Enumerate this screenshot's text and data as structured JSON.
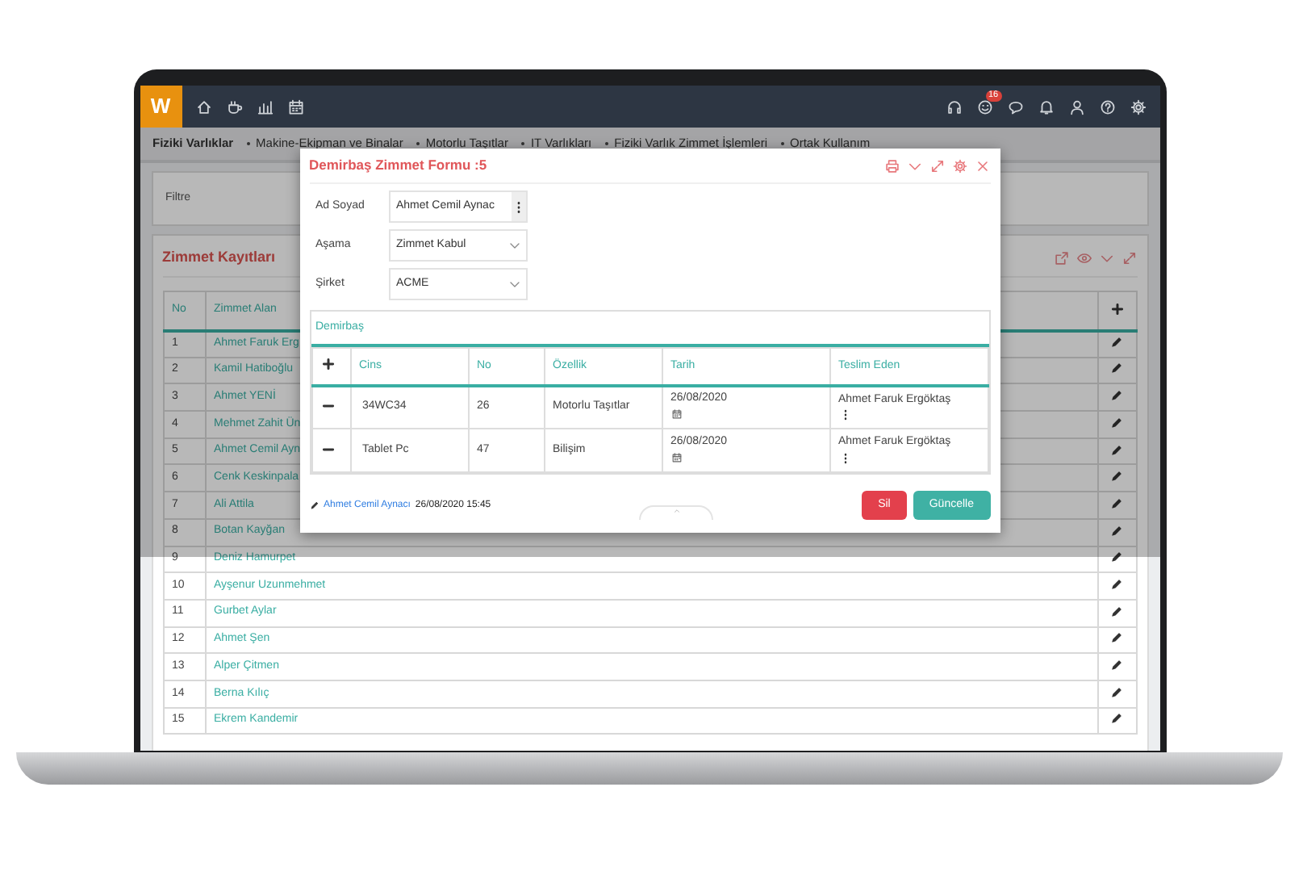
{
  "navbar": {
    "logo": "W",
    "notification_count": "16"
  },
  "breadcrumb": [
    {
      "label": "Fiziki Varlıklar",
      "kind": "root"
    },
    {
      "label": "Makine-Ekipman ve Binalar",
      "kind": "link"
    },
    {
      "label": "Motorlu Taşıtlar",
      "kind": "link"
    },
    {
      "label": "IT Varlıkları",
      "kind": "link"
    },
    {
      "label": "Fiziki Varlık Zimmet İşlemleri",
      "kind": "link"
    },
    {
      "label": "Ortak Kullanım",
      "kind": "link"
    }
  ],
  "filter": {
    "label": "Filtre"
  },
  "records": {
    "title": "Zimmet Kayıtları",
    "columns": [
      "No",
      "Zimmet Alan"
    ],
    "rows": [
      {
        "no": "1",
        "name": "Ahmet Faruk Erg"
      },
      {
        "no": "2",
        "name": "Kamil Hatiboğlu"
      },
      {
        "no": "3",
        "name": "Ahmet YENİ"
      },
      {
        "no": "4",
        "name": "Mehmet Zahit Ün"
      },
      {
        "no": "5",
        "name": "Ahmet Cemil Ayn"
      },
      {
        "no": "6",
        "name": "Cenk Keskinpala"
      },
      {
        "no": "7",
        "name": "Ali Attila"
      },
      {
        "no": "8",
        "name": "Botan Kayğan"
      },
      {
        "no": "9",
        "name": "Deniz Hamurpet"
      },
      {
        "no": "10",
        "name": "Ayşenur Uzunmehmet"
      },
      {
        "no": "11",
        "name": "Gurbet Aylar"
      },
      {
        "no": "12",
        "name": "Ahmet Şen"
      },
      {
        "no": "13",
        "name": "Alper Çitmen"
      },
      {
        "no": "14",
        "name": "Berna Kılıç"
      },
      {
        "no": "15",
        "name": "Ekrem Kandemir"
      }
    ]
  },
  "modal": {
    "title": "Demirbaş Zimmet Formu :5",
    "fields": [
      {
        "label": "Ad Soyad",
        "value": "Ahmet Cemil Aynac",
        "kind": "lookup"
      },
      {
        "label": "Aşama",
        "value": "Zimmet Kabul",
        "kind": "select"
      },
      {
        "label": "Şirket",
        "value": "ACME",
        "kind": "select"
      }
    ],
    "assets": {
      "title": "Demirbaş",
      "columns": [
        "Cins",
        "No",
        "Özellik",
        "Tarih",
        "Teslim Eden"
      ],
      "rows": [
        {
          "type": "34WC34",
          "no": "26",
          "feature": "Motorlu Taşıtlar",
          "date": "26/08/2020",
          "delivered_by": "Ahmet Faruk Ergöktaş"
        },
        {
          "type": "Tablet Pc",
          "no": "47",
          "feature": "Bilişim",
          "date": "26/08/2020",
          "delivered_by": "Ahmet Faruk Ergöktaş"
        }
      ]
    },
    "footer": {
      "author": "Ahmet Cemil Aynacı",
      "timestamp": "26/08/2020 15:45"
    },
    "buttons": [
      {
        "label": "Sil",
        "kind": "danger"
      },
      {
        "label": "Güncelle",
        "kind": "success"
      }
    ]
  }
}
